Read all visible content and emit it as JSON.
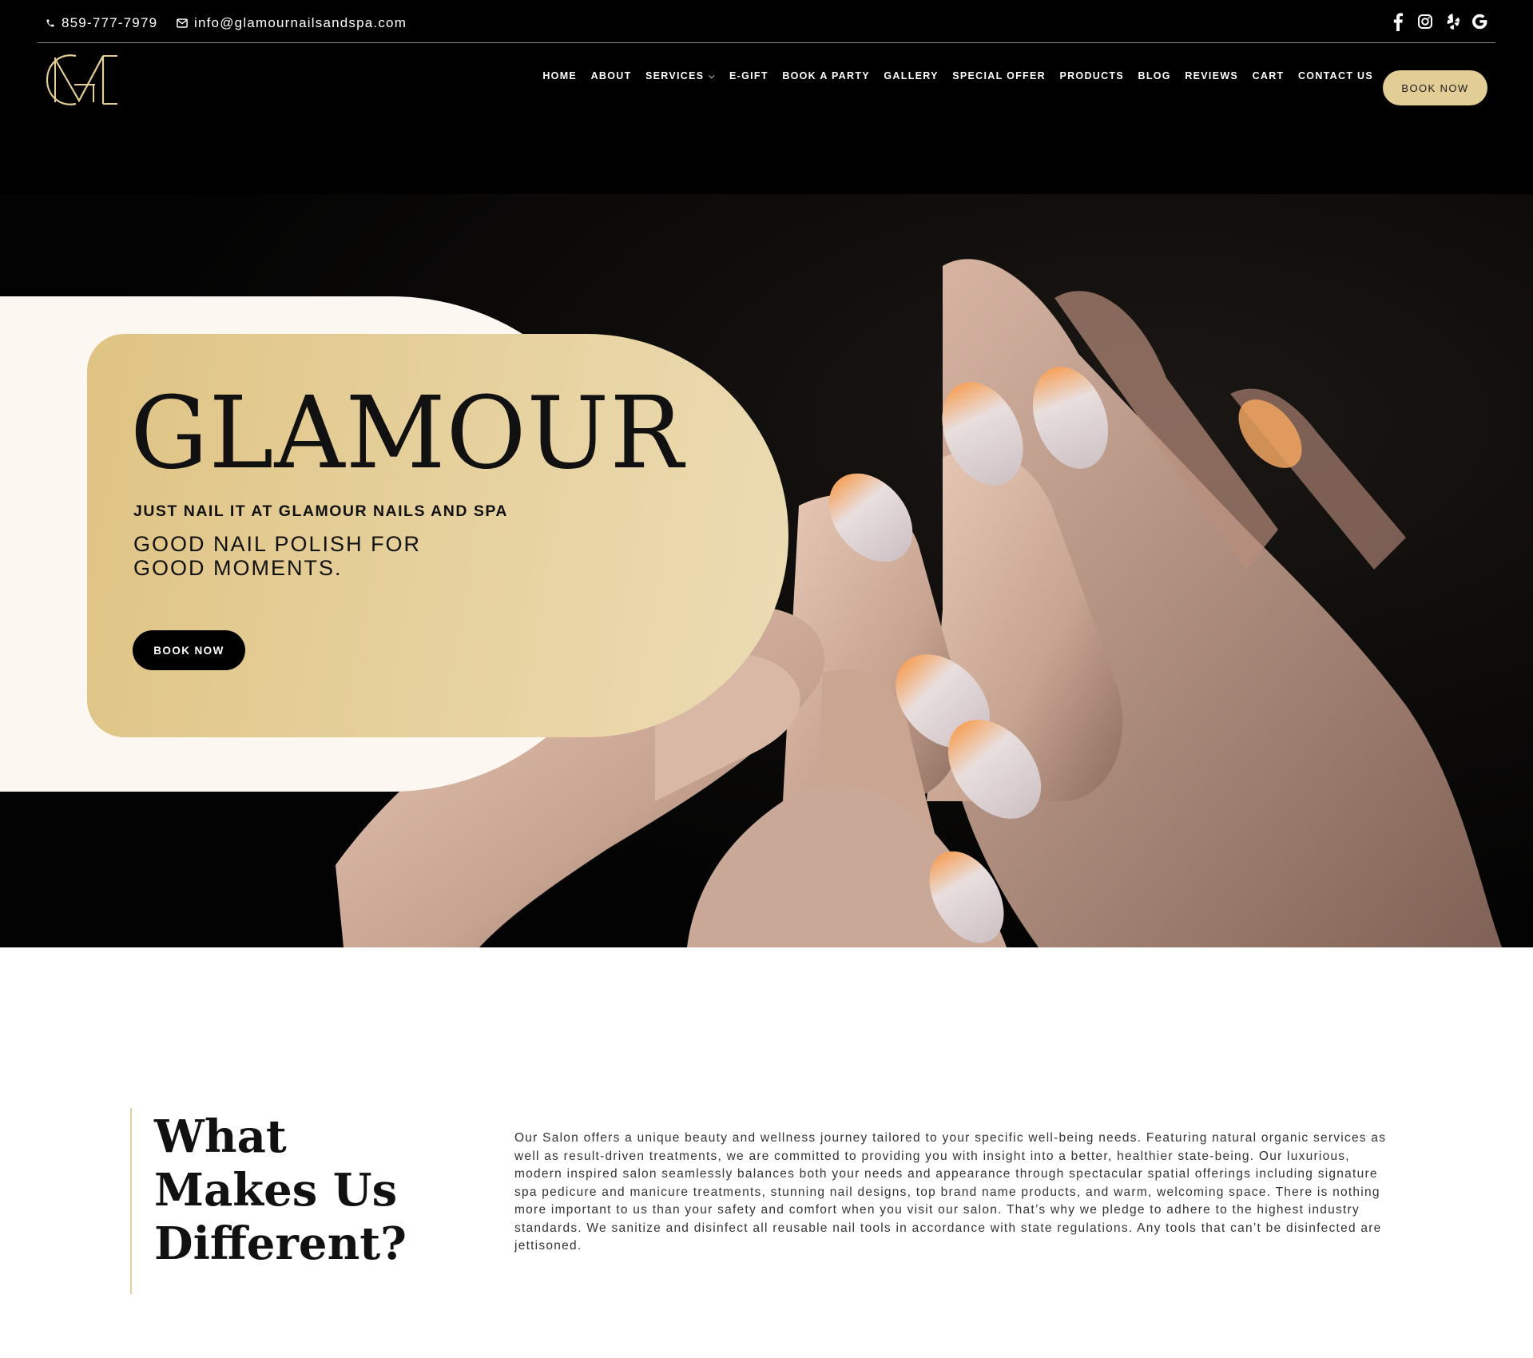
{
  "topbar": {
    "phone": "859-777-7979",
    "email": "info@glamournailsandspa.com",
    "socials": [
      "facebook-icon",
      "instagram-icon",
      "yelp-icon",
      "google-icon"
    ]
  },
  "brand": {
    "logo_letters": "GM",
    "accent_color": "#e3cd97"
  },
  "nav": {
    "items": [
      "HOME",
      "ABOUT",
      "SERVICES",
      "E-GIFT",
      "BOOK A PARTY",
      "GALLERY",
      "SPECIAL OFFER",
      "PRODUCTS",
      "BLOG",
      "REVIEWS",
      "CART",
      "CONTACT US"
    ],
    "book_label": "BOOK NOW"
  },
  "hero": {
    "title": "GLAMOUR",
    "subtitle": "JUST NAIL IT AT GLAMOUR NAILS AND SPA",
    "tagline": "GOOD NAIL POLISH FOR GOOD MOMENTS.",
    "button_label": "BOOK NOW"
  },
  "about": {
    "title": "What Makes Us Different?",
    "text": "Our Salon offers a unique beauty and wellness journey tailored to your specific well-being needs. Featuring natural organic services as well as result-driven treatments, we are committed to providing you with insight into a better, healthier state-being. Our luxurious, modern inspired salon seamlessly balances both your needs and appearance through spectacular spatial offerings including signature spa pedicure and manicure treatments, stunning nail designs, top brand name products, and warm, welcoming space. There is nothing more important to us than your safety and comfort when you visit our salon. That’s why we pledge to adhere to the highest industry standards. We sanitize and disinfect all reusable nail tools in accordance with state regulations. Any tools that can’t be disinfected are jettisoned."
  }
}
